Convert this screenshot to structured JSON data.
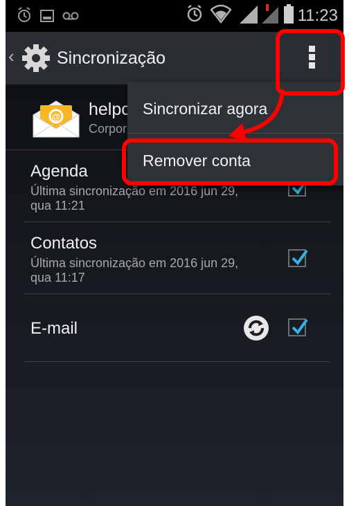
{
  "status_bar": {
    "time": "11:23",
    "icons": [
      "alarm-icon",
      "image-icon",
      "voicemail-icon",
      "alarm-icon",
      "wifi-icon",
      "signal-icon",
      "signal-no-sim-icon",
      "battery-icon"
    ]
  },
  "action_bar": {
    "title": "Sincronização",
    "icons": [
      "back-chevron-icon",
      "settings-gear-icon",
      "overflow-menu-icon"
    ]
  },
  "account": {
    "name": "helpc",
    "type": "Corpor",
    "icon": "email-envelope-icon"
  },
  "sync_items": [
    {
      "label": "Agenda",
      "last_sync": "Última sincronização em 2016 jun 29, qua 11:21",
      "checked": true
    },
    {
      "label": "Contatos",
      "last_sync": "Última sincronização em 2016 jun 29, qua 11:17",
      "checked": true
    },
    {
      "label": "E-mail",
      "last_sync": "",
      "checked": true,
      "syncing": true
    }
  ],
  "menu": {
    "items": [
      {
        "label": "Sincronizar agora"
      },
      {
        "label": "Remover conta"
      }
    ]
  },
  "colors": {
    "highlight": "#ff0000",
    "checkmark": "#33b5e5",
    "background": "#14171c"
  }
}
